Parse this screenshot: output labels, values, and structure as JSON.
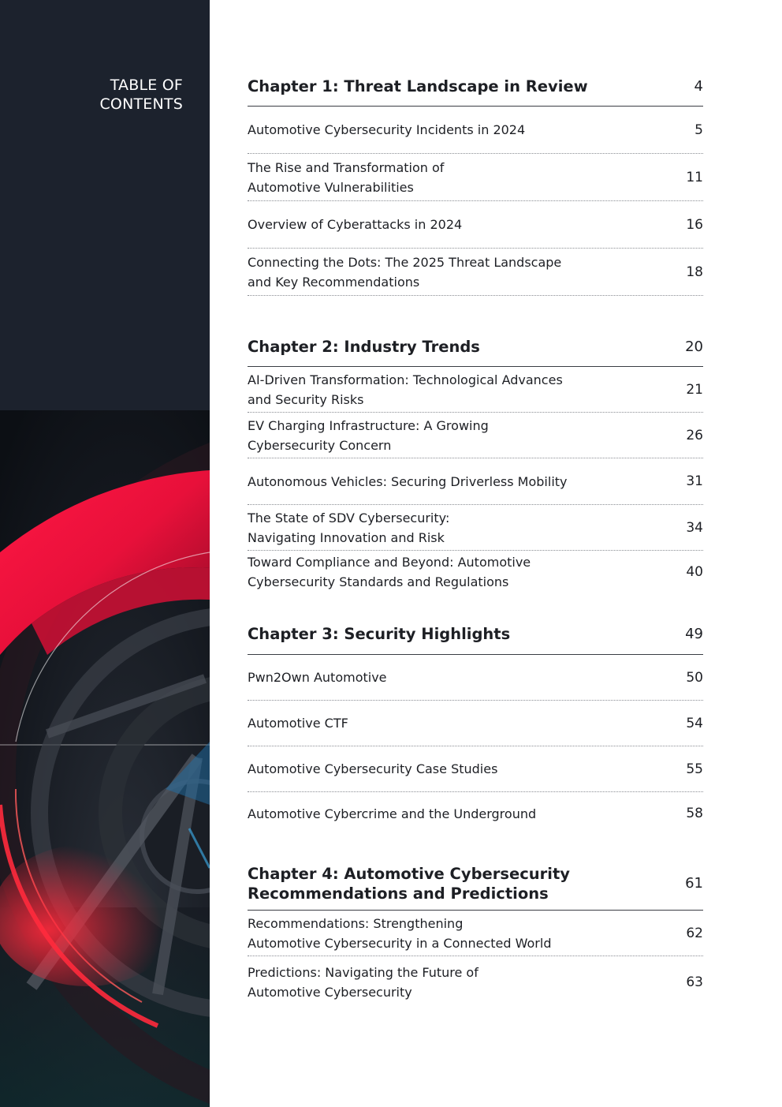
{
  "sidebar": {
    "title_line1": "TABLE OF",
    "title_line2": "CONTENTS",
    "colors": {
      "background": "#1c222d",
      "accent_red": "#e8103a"
    }
  },
  "chapters": [
    {
      "title": "Chapter 1: Threat Landscape in Review",
      "page": "4",
      "entries": [
        {
          "label": "Automotive Cybersecurity Incidents in 2024",
          "page": "5"
        },
        {
          "label": "The Rise and Transformation of\nAutomotive Vulnerabilities",
          "page": "11"
        },
        {
          "label": "Overview of Cyberattacks in 2024",
          "page": "16"
        },
        {
          "label": "Connecting the Dots: The 2025 Threat Landscape\nand Key Recommendations",
          "page": "18"
        }
      ]
    },
    {
      "title": "Chapter 2: Industry Trends",
      "page": "20",
      "entries": [
        {
          "label": "AI-Driven Transformation: Technological Advances\nand Security Risks",
          "page": "21"
        },
        {
          "label": "EV Charging Infrastructure: A Growing\nCybersecurity Concern",
          "page": "26"
        },
        {
          "label": "Autonomous Vehicles: Securing Driverless Mobility",
          "page": "31"
        },
        {
          "label": "The State of SDV Cybersecurity:\nNavigating Innovation and Risk",
          "page": "34"
        },
        {
          "label": "Toward Compliance and Beyond: Automotive\nCybersecurity Standards and Regulations",
          "page": "40"
        }
      ]
    },
    {
      "title": "Chapter 3: Security Highlights",
      "page": "49",
      "entries": [
        {
          "label": "Pwn2Own Automotive",
          "page": "50"
        },
        {
          "label": "Automotive CTF",
          "page": "54"
        },
        {
          "label": "Automotive Cybersecurity Case Studies",
          "page": "55"
        },
        {
          "label": "Automotive Cybercrime and the Underground",
          "page": "58"
        }
      ]
    },
    {
      "title": "Chapter 4: Automotive Cybersecurity\nRecommendations and Predictions",
      "page": "61",
      "entries": [
        {
          "label": "Recommendations: Strengthening\nAutomotive Cybersecurity in a Connected World",
          "page": "62"
        },
        {
          "label": "Predictions: Navigating the Future of\nAutomotive Cybersecurity",
          "page": "63"
        }
      ]
    }
  ]
}
